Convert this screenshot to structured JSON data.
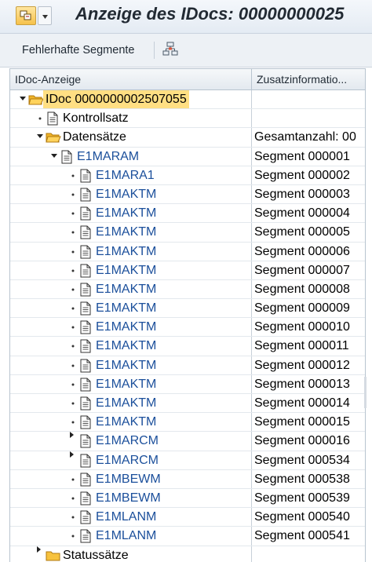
{
  "window": {
    "title": "Anzeige des IDocs: 00000000025",
    "menu_icon": "sap-menu-icon",
    "dropdown_icon": "dropdown-icon"
  },
  "toolbar": {
    "faulty_segments_label": "Fehlerhafte Segmente",
    "structure_icon": "tree-structure-icon"
  },
  "tree": {
    "columns": [
      "IDoc-Anzeige",
      "Zusatzinformatio..."
    ],
    "rows": [
      {
        "level": 0,
        "expander": "expanded",
        "icon": "folder-open-icon",
        "label": "IDoc 0000000002507055",
        "info": "",
        "style": "dark",
        "highlight": true
      },
      {
        "level": 1,
        "expander": "bullet",
        "icon": "document-icon",
        "label": "Kontrollsatz",
        "info": "",
        "style": "dark"
      },
      {
        "level": 1,
        "expander": "expanded",
        "icon": "folder-open-icon",
        "label": "Datensätze",
        "info": "Gesamtanzahl: 00",
        "style": "dark"
      },
      {
        "level": 2,
        "expander": "expanded",
        "icon": "document-icon",
        "label": "E1MARAM",
        "info": "Segment 000001",
        "style": "blue"
      },
      {
        "level": 3,
        "expander": "bullet",
        "icon": "document-icon",
        "label": "E1MARA1",
        "info": "Segment 000002",
        "style": "blue"
      },
      {
        "level": 3,
        "expander": "bullet",
        "icon": "document-icon",
        "label": "E1MAKTM",
        "info": "Segment 000003",
        "style": "blue"
      },
      {
        "level": 3,
        "expander": "bullet",
        "icon": "document-icon",
        "label": "E1MAKTM",
        "info": "Segment 000004",
        "style": "blue"
      },
      {
        "level": 3,
        "expander": "bullet",
        "icon": "document-icon",
        "label": "E1MAKTM",
        "info": "Segment 000005",
        "style": "blue"
      },
      {
        "level": 3,
        "expander": "bullet",
        "icon": "document-icon",
        "label": "E1MAKTM",
        "info": "Segment 000006",
        "style": "blue"
      },
      {
        "level": 3,
        "expander": "bullet",
        "icon": "document-icon",
        "label": "E1MAKTM",
        "info": "Segment 000007",
        "style": "blue"
      },
      {
        "level": 3,
        "expander": "bullet",
        "icon": "document-icon",
        "label": "E1MAKTM",
        "info": "Segment 000008",
        "style": "blue"
      },
      {
        "level": 3,
        "expander": "bullet",
        "icon": "document-icon",
        "label": "E1MAKTM",
        "info": "Segment 000009",
        "style": "blue"
      },
      {
        "level": 3,
        "expander": "bullet",
        "icon": "document-icon",
        "label": "E1MAKTM",
        "info": "Segment 000010",
        "style": "blue"
      },
      {
        "level": 3,
        "expander": "bullet",
        "icon": "document-icon",
        "label": "E1MAKTM",
        "info": "Segment 000011",
        "style": "blue"
      },
      {
        "level": 3,
        "expander": "bullet",
        "icon": "document-icon",
        "label": "E1MAKTM",
        "info": "Segment 000012",
        "style": "blue"
      },
      {
        "level": 3,
        "expander": "bullet",
        "icon": "document-icon",
        "label": "E1MAKTM",
        "info": "Segment 000013",
        "style": "blue"
      },
      {
        "level": 3,
        "expander": "bullet",
        "icon": "document-icon",
        "label": "E1MAKTM",
        "info": "Segment 000014",
        "style": "blue"
      },
      {
        "level": 3,
        "expander": "bullet",
        "icon": "document-icon",
        "label": "E1MAKTM",
        "info": "Segment 000015",
        "style": "blue"
      },
      {
        "level": 3,
        "expander": "collapsed",
        "icon": "document-icon",
        "label": "E1MARCM",
        "info": "Segment 000016",
        "style": "blue"
      },
      {
        "level": 3,
        "expander": "collapsed",
        "icon": "document-icon",
        "label": "E1MARCM",
        "info": "Segment 000534",
        "style": "blue"
      },
      {
        "level": 3,
        "expander": "bullet",
        "icon": "document-icon",
        "label": "E1MBEWM",
        "info": "Segment 000538",
        "style": "blue"
      },
      {
        "level": 3,
        "expander": "bullet",
        "icon": "document-icon",
        "label": "E1MBEWM",
        "info": "Segment 000539",
        "style": "blue"
      },
      {
        "level": 3,
        "expander": "bullet",
        "icon": "document-icon",
        "label": "E1MLANM",
        "info": "Segment 000540",
        "style": "blue"
      },
      {
        "level": 3,
        "expander": "bullet",
        "icon": "document-icon",
        "label": "E1MLANM",
        "info": "Segment 000541",
        "style": "blue"
      },
      {
        "level": 1,
        "expander": "collapsed",
        "icon": "folder-closed-icon",
        "label": "Statussätze",
        "info": "",
        "style": "dark"
      }
    ]
  }
}
